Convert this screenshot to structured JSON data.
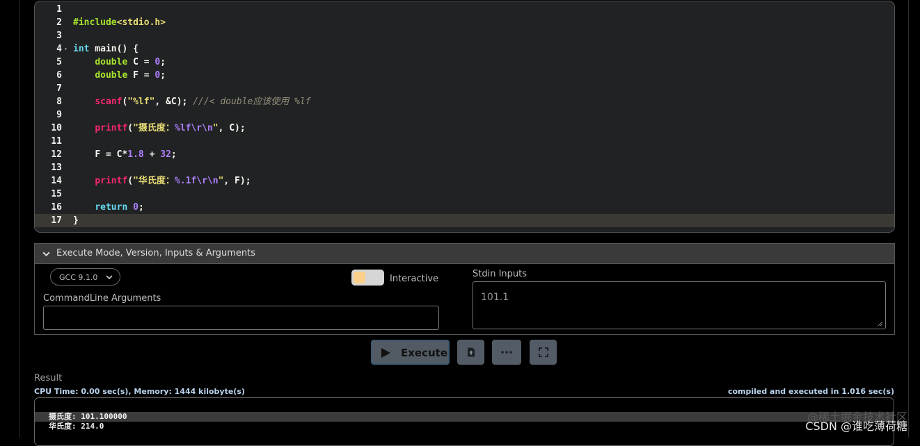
{
  "editor": {
    "lines": [
      {
        "num": "1",
        "tokens": []
      },
      {
        "num": "2",
        "tokens": [
          [
            "#include",
            "pre"
          ],
          [
            "<stdio.h>",
            "inc"
          ]
        ]
      },
      {
        "num": "3",
        "tokens": []
      },
      {
        "num": "4",
        "fold": true,
        "tokens": [
          [
            "int",
            "kw"
          ],
          [
            " main",
            "id"
          ],
          [
            "() {",
            "punc"
          ]
        ]
      },
      {
        "num": "5",
        "tokens": [
          [
            "    ",
            "id"
          ],
          [
            "double",
            "type"
          ],
          [
            " C = ",
            "id"
          ],
          [
            "0",
            "num"
          ],
          [
            ";",
            "semi"
          ]
        ]
      },
      {
        "num": "6",
        "tokens": [
          [
            "    ",
            "id"
          ],
          [
            "double",
            "type"
          ],
          [
            " F = ",
            "id"
          ],
          [
            "0",
            "num"
          ],
          [
            ";",
            "semi"
          ]
        ]
      },
      {
        "num": "7",
        "tokens": []
      },
      {
        "num": "8",
        "tokens": [
          [
            "    ",
            "id"
          ],
          [
            "scanf",
            "fn"
          ],
          [
            "(",
            "punc"
          ],
          [
            "\"%lf\"",
            "str"
          ],
          [
            ", &C); ",
            "id"
          ],
          [
            "///< double应该使用 %lf",
            "cmt"
          ]
        ]
      },
      {
        "num": "9",
        "tokens": []
      },
      {
        "num": "10",
        "tokens": [
          [
            "    ",
            "id"
          ],
          [
            "printf",
            "fn"
          ],
          [
            "(",
            "punc"
          ],
          [
            "\"摄氏度：",
            "str"
          ],
          [
            "%lf",
            "fmt"
          ],
          [
            "\\r\\n",
            "esc"
          ],
          [
            "\"",
            "str"
          ],
          [
            ", C);",
            "id"
          ]
        ]
      },
      {
        "num": "11",
        "tokens": []
      },
      {
        "num": "12",
        "tokens": [
          [
            "    ",
            "id"
          ],
          [
            "F = C*",
            "id"
          ],
          [
            "1.8",
            "num"
          ],
          [
            " + ",
            "op"
          ],
          [
            "32",
            "num"
          ],
          [
            ";",
            "semi"
          ]
        ]
      },
      {
        "num": "13",
        "tokens": []
      },
      {
        "num": "14",
        "tokens": [
          [
            "    ",
            "id"
          ],
          [
            "printf",
            "fn"
          ],
          [
            "(",
            "punc"
          ],
          [
            "\"华氏度：",
            "str"
          ],
          [
            "%.1f",
            "fmt"
          ],
          [
            "\\r\\n",
            "esc"
          ],
          [
            "\"",
            "str"
          ],
          [
            ", F);",
            "id"
          ]
        ]
      },
      {
        "num": "15",
        "tokens": []
      },
      {
        "num": "16",
        "tokens": [
          [
            "    ",
            "id"
          ],
          [
            "return",
            "kw"
          ],
          [
            " ",
            "id"
          ],
          [
            "0",
            "num"
          ],
          [
            ";",
            "semi"
          ]
        ]
      },
      {
        "num": "17",
        "active": true,
        "tokens": [
          [
            "}",
            "punc"
          ]
        ]
      }
    ]
  },
  "execute_panel": {
    "title": "Execute Mode, Version, Inputs & Arguments",
    "version": "GCC 9.1.0",
    "interactive_label": "Interactive",
    "interactive_on": false,
    "cmdline_label": "CommandLine Arguments",
    "cmdline_value": "",
    "stdin_label": "Stdin Inputs",
    "stdin_value": "101.1"
  },
  "buttons": {
    "execute_label": "Execute",
    "upload_icon": "upload-file-icon",
    "more_icon": "more-dots-icon",
    "fullscreen_icon": "fullscreen-icon"
  },
  "result": {
    "label": "Result",
    "cpu_info": "CPU Time: 0.00 sec(s), Memory: 1444 kilobyte(s)",
    "compiled_info": "compiled and executed in 1.016 sec(s)",
    "output_lines": [
      "摄氏度: 101.100000",
      "华氏度: 214.0"
    ]
  },
  "watermark": {
    "line1": "@稀土掘金技术社区",
    "line2": "CSDN @谁吃薄荷糖"
  },
  "colors": {
    "editor_bg": "#212223",
    "panel_header_bg": "#3a3a3a",
    "button_bg": "#535c66",
    "info_text": "#b9d3ee"
  }
}
